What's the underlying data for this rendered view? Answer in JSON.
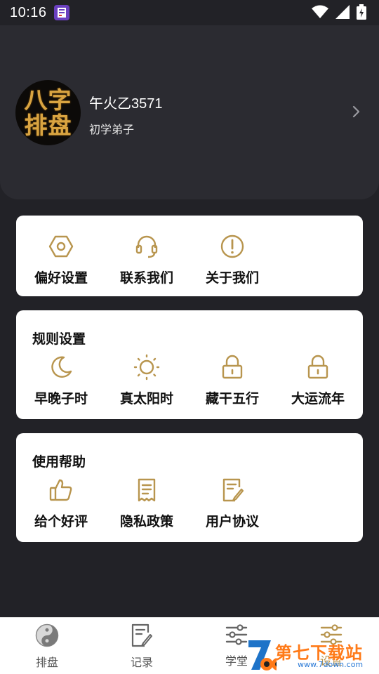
{
  "status_bar": {
    "time": "10:16"
  },
  "profile": {
    "avatar_text_line1": "八字",
    "avatar_text_line2": "排盘",
    "name": "午火乙3571",
    "level": "初学弟子"
  },
  "quick_links": [
    {
      "label": "偏好设置",
      "icon": "settings-hexagon-icon"
    },
    {
      "label": "联系我们",
      "icon": "headset-icon"
    },
    {
      "label": "关于我们",
      "icon": "info-exclamation-icon"
    }
  ],
  "rules": {
    "title": "规则设置",
    "items": [
      {
        "label": "早晚子时",
        "icon": "moon-icon"
      },
      {
        "label": "真太阳时",
        "icon": "sun-icon"
      },
      {
        "label": "藏干五行",
        "icon": "lock-icon"
      },
      {
        "label": "大运流年",
        "icon": "lock-icon"
      }
    ]
  },
  "help": {
    "title": "使用帮助",
    "items": [
      {
        "label": "给个好评",
        "icon": "thumbs-up-icon"
      },
      {
        "label": "隐私政策",
        "icon": "document-icon"
      },
      {
        "label": "用户协议",
        "icon": "document-edit-icon"
      }
    ]
  },
  "bottom_nav": [
    {
      "label": "排盘",
      "icon": "yin-yang-icon"
    },
    {
      "label": "记录",
      "icon": "record-icon"
    },
    {
      "label": "学堂",
      "icon": "sliders-icon"
    },
    {
      "label": "设置",
      "icon": "sliders-icon",
      "active": true
    }
  ],
  "watermark": {
    "text": "第七下载站",
    "url": "www.7down.com"
  },
  "colors": {
    "accent": "#b8954e",
    "background": "#222227",
    "header": "#2b2b31",
    "card": "#ffffff"
  }
}
